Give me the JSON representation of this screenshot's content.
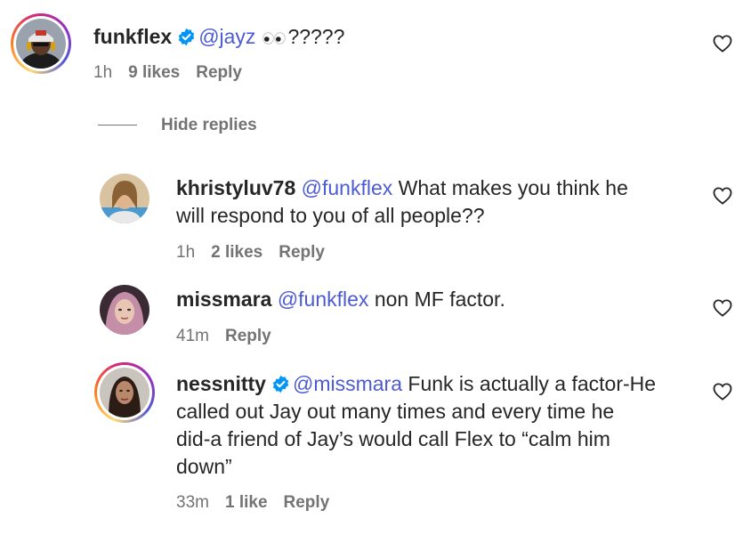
{
  "comments": [
    {
      "username": "funkflex",
      "verified": true,
      "mention": "@jayz",
      "emoji": "eyes-emoji",
      "text": "?????",
      "time": "1h",
      "likes": "9 likes",
      "reply": "Reply"
    },
    {
      "username": "khristyluv78",
      "verified": false,
      "mention": "@funkflex",
      "text": "What makes you think he",
      "text_line2": "will respond to you of all people??",
      "time": "1h",
      "likes": "2 likes",
      "reply": "Reply"
    },
    {
      "username": "missmara",
      "verified": false,
      "mention": "@funkflex",
      "text": "non MF factor.",
      "time": "41m",
      "reply": "Reply"
    },
    {
      "username": "nessnitty",
      "verified": true,
      "mention": "@missmara",
      "text": "Funk is actually a factor-He",
      "text_line2": "called out Jay out many times and every time he",
      "text_line3": "did-a friend of Jay’s would call Flex to “calm him",
      "text_line4": "down”",
      "time": "33m",
      "likes": "1 like",
      "reply": "Reply"
    }
  ],
  "hide_replies": "Hide replies",
  "colors": {
    "mention": "#4c5bd4",
    "meta": "#737373",
    "verified": "#0095f6",
    "text": "#262626"
  }
}
